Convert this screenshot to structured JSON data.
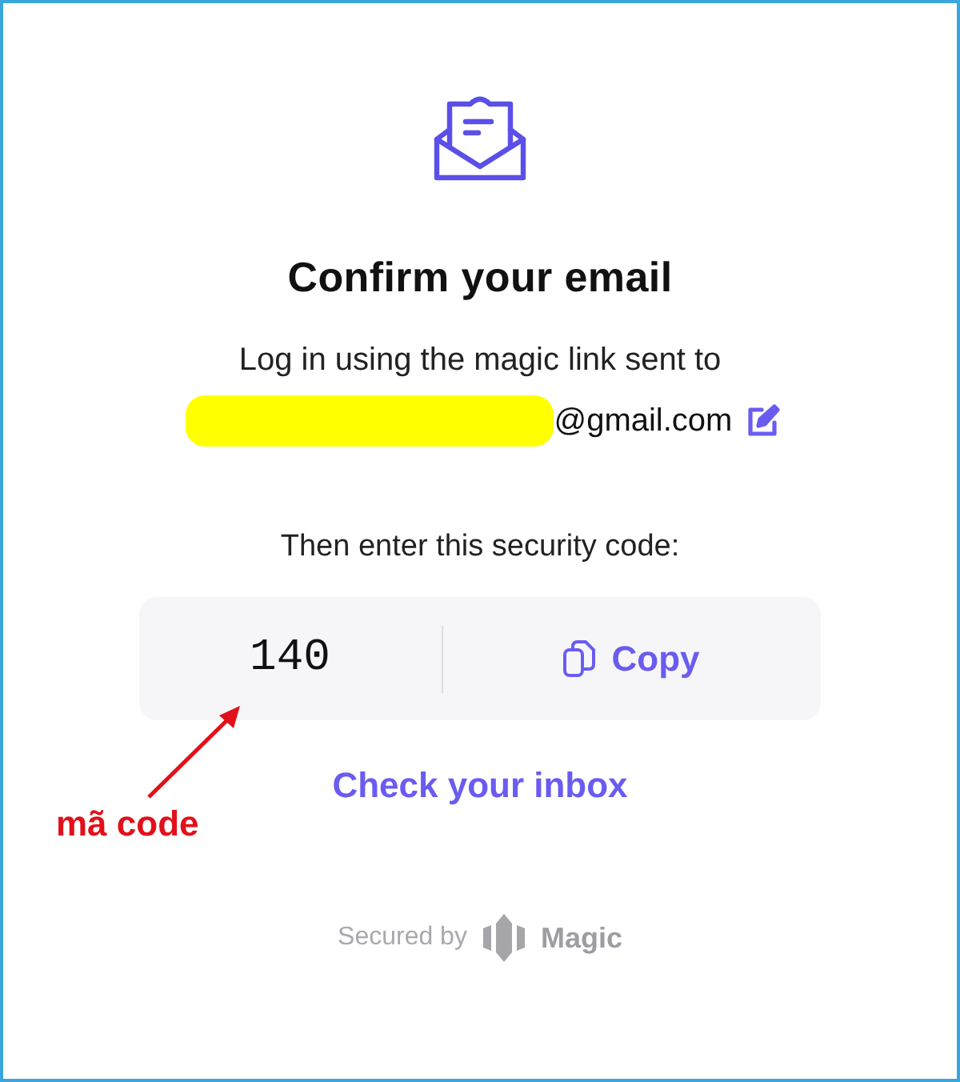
{
  "dialog": {
    "title": "Confirm your email",
    "message": "Log in using the magic link sent to",
    "email": {
      "visible_part": "@gmail.com",
      "redacted": true
    },
    "code_prompt": "Then enter this security code:",
    "code": "140",
    "copy_button": "Copy",
    "inbox_link": "Check your inbox",
    "footer": {
      "prefix": "Secured by",
      "brand": "Magic"
    }
  },
  "annotation": {
    "label": "mã code"
  }
}
